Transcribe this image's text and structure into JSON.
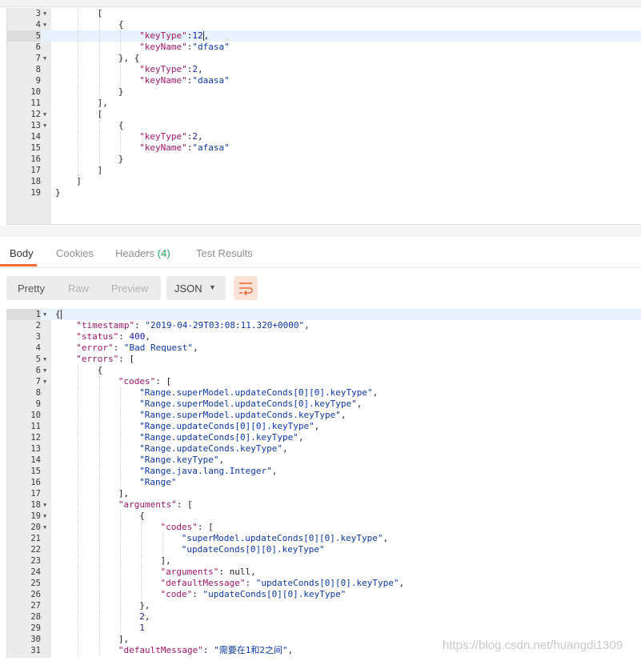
{
  "request_editor": {
    "lines": [
      {
        "n": "3",
        "fold": true,
        "indent": 2,
        "parts": [
          [
            "p",
            "["
          ]
        ]
      },
      {
        "n": "4",
        "fold": true,
        "indent": 3,
        "parts": [
          [
            "p",
            "{"
          ]
        ]
      },
      {
        "n": "5",
        "fold": false,
        "indent": 4,
        "active": true,
        "parts": [
          [
            "k",
            "\"keyType\""
          ],
          [
            "p",
            ":"
          ],
          [
            "n",
            "12"
          ],
          [
            "p",
            ","
          ]
        ]
      },
      {
        "n": "6",
        "fold": false,
        "indent": 4,
        "parts": [
          [
            "k",
            "\"keyName\""
          ],
          [
            "p",
            ":"
          ],
          [
            "s",
            "\"dfasa\""
          ]
        ]
      },
      {
        "n": "7",
        "fold": true,
        "indent": 3,
        "parts": [
          [
            "p",
            "}, {"
          ]
        ]
      },
      {
        "n": "8",
        "fold": false,
        "indent": 4,
        "parts": [
          [
            "k",
            "\"keyType\""
          ],
          [
            "p",
            ":"
          ],
          [
            "n",
            "2"
          ],
          [
            "p",
            ","
          ]
        ]
      },
      {
        "n": "9",
        "fold": false,
        "indent": 4,
        "parts": [
          [
            "k",
            "\"keyName\""
          ],
          [
            "p",
            ":"
          ],
          [
            "s",
            "\"daasa\""
          ]
        ]
      },
      {
        "n": "10",
        "fold": false,
        "indent": 3,
        "parts": [
          [
            "p",
            "}"
          ]
        ]
      },
      {
        "n": "11",
        "fold": false,
        "indent": 2,
        "parts": [
          [
            "p",
            "],"
          ]
        ]
      },
      {
        "n": "12",
        "fold": true,
        "indent": 2,
        "parts": [
          [
            "p",
            "["
          ]
        ]
      },
      {
        "n": "13",
        "fold": true,
        "indent": 3,
        "parts": [
          [
            "p",
            "{"
          ]
        ]
      },
      {
        "n": "14",
        "fold": false,
        "indent": 4,
        "parts": [
          [
            "k",
            "\"keyType\""
          ],
          [
            "p",
            ":"
          ],
          [
            "n",
            "2"
          ],
          [
            "p",
            ","
          ]
        ]
      },
      {
        "n": "15",
        "fold": false,
        "indent": 4,
        "parts": [
          [
            "k",
            "\"keyName\""
          ],
          [
            "p",
            ":"
          ],
          [
            "s",
            "\"afasa\""
          ]
        ]
      },
      {
        "n": "16",
        "fold": false,
        "indent": 3,
        "parts": [
          [
            "p",
            "}"
          ]
        ]
      },
      {
        "n": "17",
        "fold": false,
        "indent": 2,
        "parts": [
          [
            "p",
            "]"
          ]
        ]
      },
      {
        "n": "18",
        "fold": false,
        "indent": 1,
        "parts": [
          [
            "p",
            "]"
          ]
        ]
      },
      {
        "n": "19",
        "fold": false,
        "indent": 0,
        "parts": [
          [
            "p",
            "}"
          ]
        ]
      }
    ]
  },
  "response_tabs": {
    "body": "Body",
    "cookies": "Cookies",
    "headers": "Headers",
    "headers_count": "(4)",
    "test_results": "Test Results"
  },
  "toolbar": {
    "pretty": "Pretty",
    "raw": "Raw",
    "preview": "Preview",
    "format": "JSON",
    "wrap_icon": "wrap-lines-icon",
    "accent_color": "#f26b3a"
  },
  "response_editor": {
    "lines": [
      {
        "n": "1",
        "fold": true,
        "indent": 0,
        "active": true,
        "parts": [
          [
            "p",
            "{"
          ]
        ]
      },
      {
        "n": "2",
        "fold": false,
        "indent": 1,
        "parts": [
          [
            "k",
            "\"timestamp\""
          ],
          [
            "p",
            ": "
          ],
          [
            "s",
            "\"2019-04-29T03:08:11.320+0000\""
          ],
          [
            "p",
            ","
          ]
        ]
      },
      {
        "n": "3",
        "fold": false,
        "indent": 1,
        "parts": [
          [
            "k",
            "\"status\""
          ],
          [
            "p",
            ": "
          ],
          [
            "n",
            "400"
          ],
          [
            "p",
            ","
          ]
        ]
      },
      {
        "n": "4",
        "fold": false,
        "indent": 1,
        "parts": [
          [
            "k",
            "\"error\""
          ],
          [
            "p",
            ": "
          ],
          [
            "s",
            "\"Bad Request\""
          ],
          [
            "p",
            ","
          ]
        ]
      },
      {
        "n": "5",
        "fold": true,
        "indent": 1,
        "parts": [
          [
            "k",
            "\"errors\""
          ],
          [
            "p",
            ": ["
          ]
        ]
      },
      {
        "n": "6",
        "fold": true,
        "indent": 2,
        "parts": [
          [
            "p",
            "{"
          ]
        ]
      },
      {
        "n": "7",
        "fold": true,
        "indent": 3,
        "parts": [
          [
            "k",
            "\"codes\""
          ],
          [
            "p",
            ": ["
          ]
        ]
      },
      {
        "n": "8",
        "fold": false,
        "indent": 4,
        "parts": [
          [
            "s",
            "\"Range.superModel.updateConds[0][0].keyType\""
          ],
          [
            "p",
            ","
          ]
        ]
      },
      {
        "n": "9",
        "fold": false,
        "indent": 4,
        "parts": [
          [
            "s",
            "\"Range.superModel.updateConds[0].keyType\""
          ],
          [
            "p",
            ","
          ]
        ]
      },
      {
        "n": "10",
        "fold": false,
        "indent": 4,
        "parts": [
          [
            "s",
            "\"Range.superModel.updateConds.keyType\""
          ],
          [
            "p",
            ","
          ]
        ]
      },
      {
        "n": "11",
        "fold": false,
        "indent": 4,
        "parts": [
          [
            "s",
            "\"Range.updateConds[0][0].keyType\""
          ],
          [
            "p",
            ","
          ]
        ]
      },
      {
        "n": "12",
        "fold": false,
        "indent": 4,
        "parts": [
          [
            "s",
            "\"Range.updateConds[0].keyType\""
          ],
          [
            "p",
            ","
          ]
        ]
      },
      {
        "n": "13",
        "fold": false,
        "indent": 4,
        "parts": [
          [
            "s",
            "\"Range.updateConds.keyType\""
          ],
          [
            "p",
            ","
          ]
        ]
      },
      {
        "n": "14",
        "fold": false,
        "indent": 4,
        "parts": [
          [
            "s",
            "\"Range.keyType\""
          ],
          [
            "p",
            ","
          ]
        ]
      },
      {
        "n": "15",
        "fold": false,
        "indent": 4,
        "parts": [
          [
            "s",
            "\"Range.java.lang.Integer\""
          ],
          [
            "p",
            ","
          ]
        ]
      },
      {
        "n": "16",
        "fold": false,
        "indent": 4,
        "parts": [
          [
            "s",
            "\"Range\""
          ]
        ]
      },
      {
        "n": "17",
        "fold": false,
        "indent": 3,
        "parts": [
          [
            "p",
            "],"
          ]
        ]
      },
      {
        "n": "18",
        "fold": true,
        "indent": 3,
        "parts": [
          [
            "k",
            "\"arguments\""
          ],
          [
            "p",
            ": ["
          ]
        ]
      },
      {
        "n": "19",
        "fold": true,
        "indent": 4,
        "parts": [
          [
            "p",
            "{"
          ]
        ]
      },
      {
        "n": "20",
        "fold": true,
        "indent": 5,
        "parts": [
          [
            "k",
            "\"codes\""
          ],
          [
            "p",
            ": ["
          ]
        ]
      },
      {
        "n": "21",
        "fold": false,
        "indent": 6,
        "parts": [
          [
            "s",
            "\"superModel.updateConds[0][0].keyType\""
          ],
          [
            "p",
            ","
          ]
        ]
      },
      {
        "n": "22",
        "fold": false,
        "indent": 6,
        "parts": [
          [
            "s",
            "\"updateConds[0][0].keyType\""
          ]
        ]
      },
      {
        "n": "23",
        "fold": false,
        "indent": 5,
        "parts": [
          [
            "p",
            "],"
          ]
        ]
      },
      {
        "n": "24",
        "fold": false,
        "indent": 5,
        "parts": [
          [
            "k",
            "\"arguments\""
          ],
          [
            "p",
            ": null,"
          ]
        ]
      },
      {
        "n": "25",
        "fold": false,
        "indent": 5,
        "parts": [
          [
            "k",
            "\"defaultMessage\""
          ],
          [
            "p",
            ": "
          ],
          [
            "s",
            "\"updateConds[0][0].keyType\""
          ],
          [
            "p",
            ","
          ]
        ]
      },
      {
        "n": "26",
        "fold": false,
        "indent": 5,
        "parts": [
          [
            "k",
            "\"code\""
          ],
          [
            "p",
            ": "
          ],
          [
            "s",
            "\"updateConds[0][0].keyType\""
          ]
        ]
      },
      {
        "n": "27",
        "fold": false,
        "indent": 4,
        "parts": [
          [
            "p",
            "},"
          ]
        ]
      },
      {
        "n": "28",
        "fold": false,
        "indent": 4,
        "parts": [
          [
            "n",
            "2"
          ],
          [
            "p",
            ","
          ]
        ]
      },
      {
        "n": "29",
        "fold": false,
        "indent": 4,
        "parts": [
          [
            "n",
            "1"
          ]
        ]
      },
      {
        "n": "30",
        "fold": false,
        "indent": 3,
        "parts": [
          [
            "p",
            "],"
          ]
        ]
      },
      {
        "n": "31",
        "fold": false,
        "indent": 3,
        "parts": [
          [
            "k",
            "\"defaultMessage\""
          ],
          [
            "p",
            ": "
          ],
          [
            "s",
            "\"需要在1和2之间\""
          ],
          [
            "p",
            ","
          ]
        ]
      }
    ]
  },
  "watermark": "https://blog.csdn.net/huangdi1309"
}
